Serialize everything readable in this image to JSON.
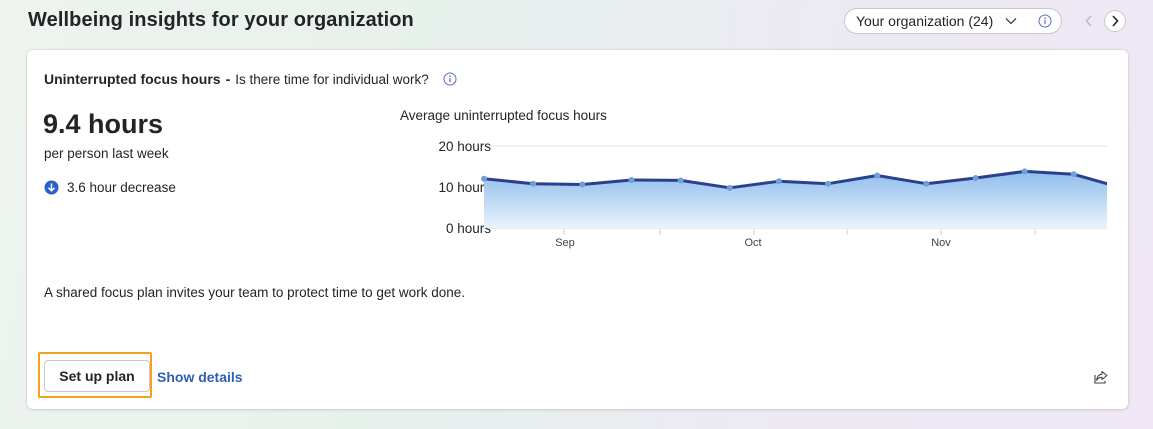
{
  "header": {
    "title": "Wellbeing insights for your organization",
    "org_selector": {
      "value": "Your organization (24)"
    },
    "icons": {
      "dropdown": "chevron-down-icon",
      "info": "info-icon",
      "prev": "chevron-left-icon",
      "next": "chevron-right-icon"
    }
  },
  "card": {
    "title": "Uninterrupted focus hours",
    "separator": "-",
    "subtitle": "Is there time for individual work?",
    "metric": {
      "value": "9.4 hours",
      "caption": "per person last week",
      "trend_text": "3.6 hour decrease",
      "trend_icon": "arrow-down-circle-icon"
    },
    "description": "A shared focus plan invites your team to protect time to get work done.",
    "actions": {
      "primary_label": "Set up plan",
      "link_label": "Show details",
      "share_icon": "share-icon"
    }
  },
  "colors": {
    "line": "#2b3f8f",
    "marker": "#6f9fd8",
    "area_top": "#8fbdec",
    "area_bottom": "#eaf3fd",
    "link": "#2f5fb3",
    "focus_ring": "#f2a11c"
  },
  "chart_data": {
    "type": "area",
    "title": "Average uninterrupted focus hours",
    "y_ticks": [
      "20 hours",
      "10 hours",
      "0 hours"
    ],
    "ylim": [
      0,
      20
    ],
    "x_tick_labels": [
      "Sep",
      "Oct",
      "Nov"
    ],
    "grid": "horizontal",
    "series": [
      {
        "values": [
          12,
          10.8,
          10.6,
          11.7,
          11.6,
          9.8,
          11.4,
          10.8,
          12.8,
          10.8,
          12.2,
          13.8,
          13.1,
          9.7
        ]
      }
    ]
  }
}
